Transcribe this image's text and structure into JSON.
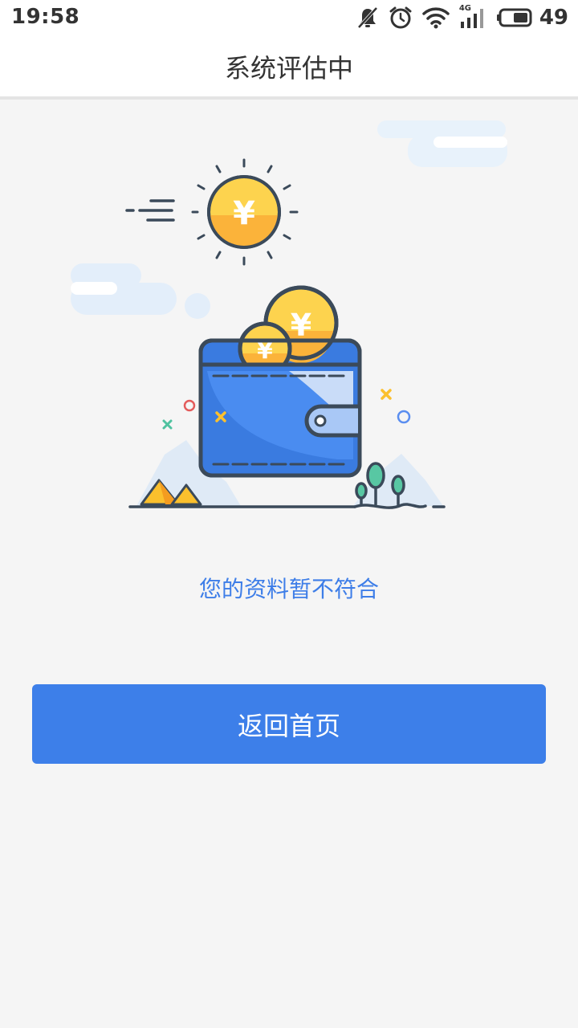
{
  "status_bar": {
    "time": "19:58",
    "network": "4G",
    "battery_level": "49",
    "icons": [
      "mute-bell-icon",
      "alarm-icon",
      "wifi-icon",
      "signal-icon",
      "battery-icon"
    ]
  },
  "header": {
    "title": "系统评估中"
  },
  "illustration": {
    "icon": "wallet-coins-illustration",
    "coin_symbol": "¥"
  },
  "main": {
    "message": "您的资料暂不符合",
    "home_button_label": "返回首页"
  },
  "colors": {
    "accent": "#3d7fe9",
    "message_text": "#3e7ee8",
    "background": "#f5f5f5",
    "coin_yellow": "#fbc02d",
    "wallet_blue": "#3a7be0"
  }
}
